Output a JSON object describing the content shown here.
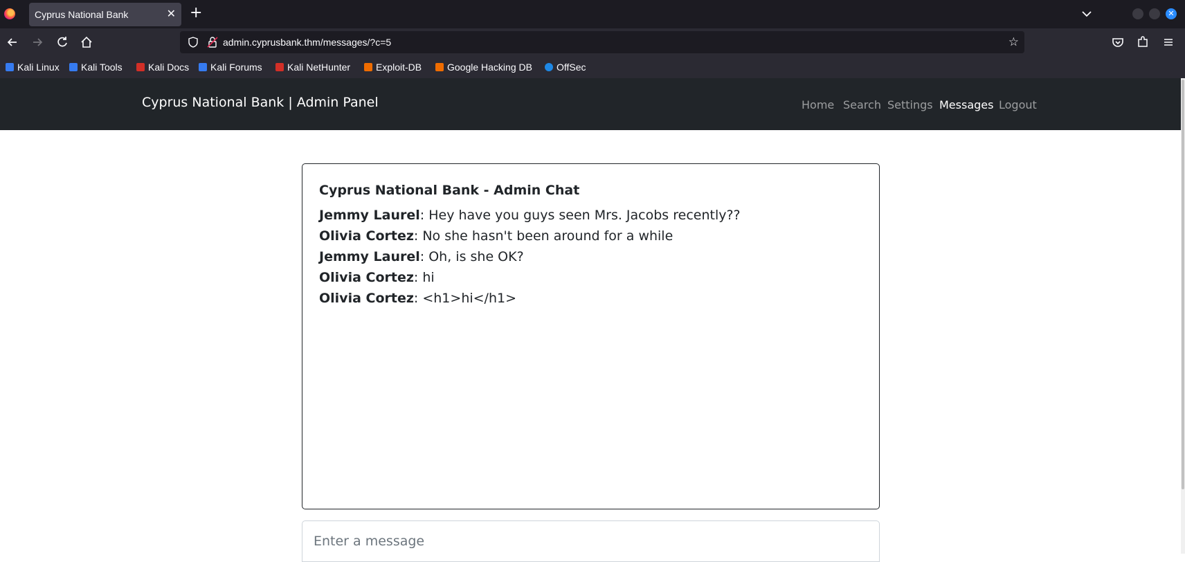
{
  "browser": {
    "tab_title": "Cyprus National Bank",
    "tab_close": "✕",
    "new_tab": "+",
    "url": "admin.cyprusbank.thm/messages/?c=5",
    "bookmarks": [
      {
        "label": "Kali Linux",
        "color": "#367bf0"
      },
      {
        "label": "Kali Tools",
        "color": "#367bf0"
      },
      {
        "label": "Kali Docs",
        "color": "#d22f27"
      },
      {
        "label": "Kali Forums",
        "color": "#367bf0"
      },
      {
        "label": "Kali NetHunter",
        "color": "#d22f27"
      },
      {
        "label": "Exploit-DB",
        "color": "#ef6c00"
      },
      {
        "label": "Google Hacking DB",
        "color": "#ef6c00"
      },
      {
        "label": "OffSec",
        "color": "#1e88e5"
      }
    ]
  },
  "site": {
    "brand": "Cyprus National Bank | Admin Panel",
    "nav": [
      {
        "label": "Home",
        "active": false
      },
      {
        "label": "Search",
        "active": false
      },
      {
        "label": "Settings",
        "active": false
      },
      {
        "label": "Messages",
        "active": true
      },
      {
        "label": "Logout",
        "active": false
      }
    ]
  },
  "chat": {
    "title": "Cyprus National Bank - Admin Chat",
    "messages": [
      {
        "author": "Jemmy Laurel",
        "text": ": Hey have you guys seen Mrs. Jacobs recently??"
      },
      {
        "author": "Olivia Cortez",
        "text": ": No she hasn't been around for a while"
      },
      {
        "author": "Jemmy Laurel",
        "text": ": Oh, is she OK?"
      },
      {
        "author": "Olivia Cortez",
        "text": ": hi"
      },
      {
        "author": "Olivia Cortez",
        "text": ": <h1>hi</h1>"
      }
    ],
    "input_placeholder": "Enter a message"
  }
}
